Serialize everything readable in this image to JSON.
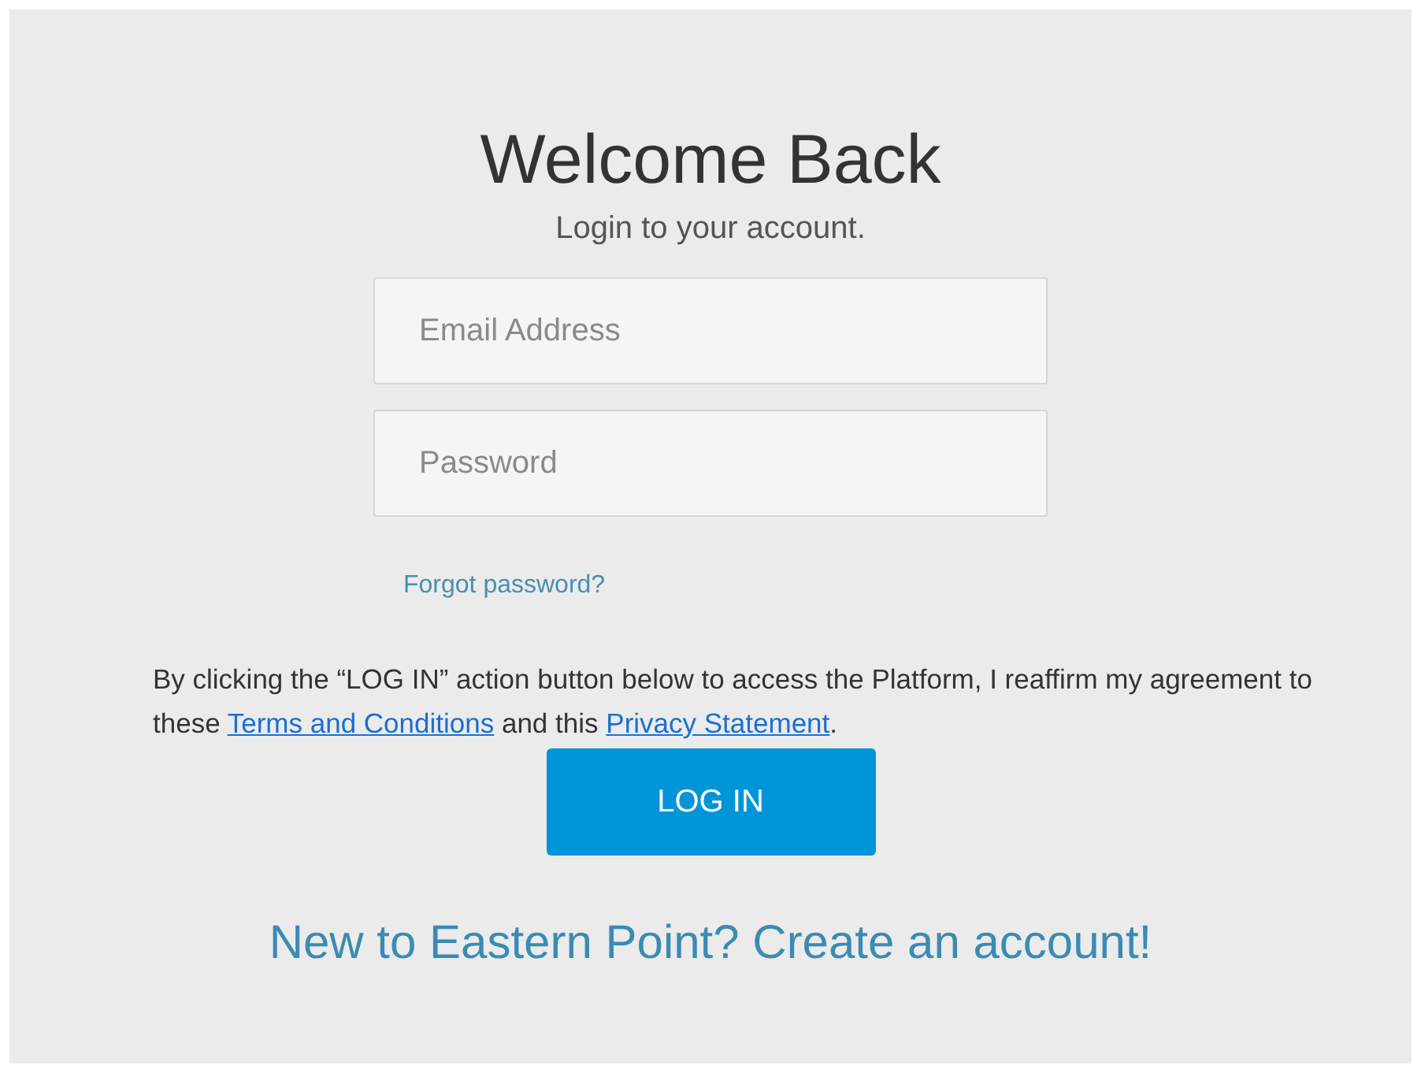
{
  "heading": "Welcome Back",
  "subtitle": "Login to your account.",
  "fields": [
    {
      "placeholder": "Email Address"
    },
    {
      "placeholder": "Password"
    }
  ],
  "forgot_link": "Forgot password?",
  "consent": {
    "text_before": "By clicking the “LOG IN” action button below to access the Platform, I reaffirm my agreement to these ",
    "terms_link": "Terms and Conditions",
    "text_middle": " and this ",
    "privacy_link": "Privacy Statement",
    "text_after": "."
  },
  "login_button": "LOG IN",
  "signup_link": "New to Eastern Point? Create an account!"
}
